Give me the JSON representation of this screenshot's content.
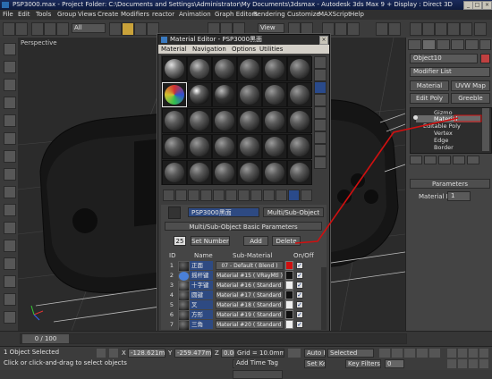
{
  "window": {
    "title": "PSP3000.max    - Project Folder: C:\\Documents and Settings\\Administrator\\My Documents\\3dsmax    - Autodesk 3ds Max 9     + Display : Direct 3D",
    "min_label": "_",
    "max_label": "□",
    "close_label": "×"
  },
  "menu": [
    "File",
    "Edit",
    "Tools",
    "Group",
    "Views",
    "Create",
    "Modifiers",
    "reactor",
    "Animation",
    "Graph Editors",
    "Rendering",
    "Customize",
    "MAXScript",
    "Help"
  ],
  "toolbar": {
    "selection_filter": "All",
    "view_dropdown": "View"
  },
  "viewport": {
    "label": "Perspective"
  },
  "material_editor": {
    "title": "Material Editor - PSP3000黑面",
    "menu": [
      "Material",
      "Navigation",
      "Options",
      "Utilities"
    ],
    "material_name": "PSP3000黑面",
    "material_type": "Multi/Sub-Object",
    "rollout_title": "Multi/Sub-Object Basic Parameters",
    "num_materials": "25",
    "set_number_label": "Set Number",
    "add_label": "Add",
    "delete_label": "Delete",
    "columns": {
      "id": "ID",
      "name": "Name",
      "sub_material": "Sub-Material",
      "on_off": "On/Off"
    },
    "rows": [
      {
        "id": "1",
        "name": "正面",
        "sub": "07 - Default  ( Blend )"
      },
      {
        "id": "2",
        "name": "摇杆键",
        "sub": "Material #15  ( VRayMtl )"
      },
      {
        "id": "3",
        "name": "十字键",
        "sub": "Material #16  ( Standard )"
      },
      {
        "id": "4",
        "name": "圆键",
        "sub": "Material #17  ( Standard )"
      },
      {
        "id": "5",
        "name": "叉",
        "sub": "Material #18  ( Standard )"
      },
      {
        "id": "6",
        "name": "方形",
        "sub": "Material #19  ( Standard )"
      },
      {
        "id": "7",
        "name": "三角",
        "sub": "Material #20  ( Standard )"
      }
    ]
  },
  "command_panel": {
    "object_name": "Object10",
    "modifier_list": "Modifier List",
    "buttons": [
      "Material",
      "UVW Map",
      "Edit Poly",
      "Greeble"
    ],
    "stack_items": [
      "Gizmo",
      "Material",
      "Editable Poly",
      "Vertex",
      "Edge",
      "Border"
    ],
    "parameters_title": "Parameters",
    "material_id_label": "Material ID:",
    "material_id_value": "1"
  },
  "timeline": {
    "position": "0 / 100"
  },
  "status": {
    "selection": "1 Object Selected",
    "prompt": "Click or click-and-drag to select objects",
    "x_label": "X",
    "x_value": "-128.621mm",
    "y_label": "Y",
    "y_value": "-259.477m",
    "z_label": "Z",
    "z_value": "0.0mm",
    "grid": "Grid = 10.0mm",
    "add_time_tag": "Add Time Tag",
    "auto_key": "Auto Key",
    "selected": "Selected",
    "set_key": "Set Key",
    "key_filters": "Key Filters...",
    "frame": "0"
  },
  "colors": {
    "accent_blue": "#2e4a82",
    "highlight_red": "#d01010",
    "selected_blue": "#3a5ea8"
  }
}
